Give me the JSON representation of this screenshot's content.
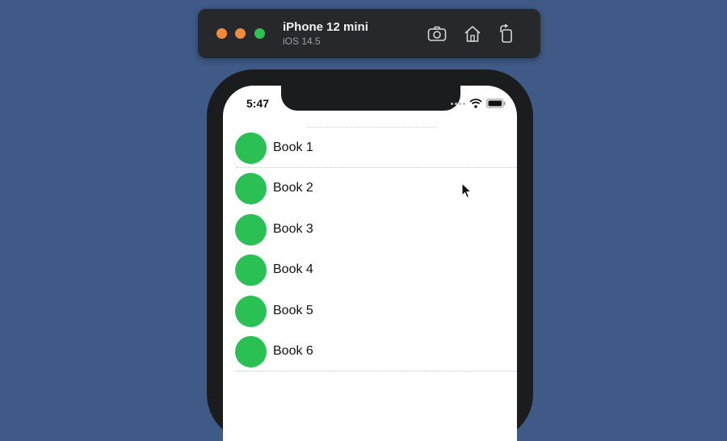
{
  "simulator": {
    "device_name": "iPhone 12 mini",
    "os_version": "iOS 14.5",
    "toolbar_icons": [
      "screenshot-icon",
      "home-icon",
      "rotate-icon"
    ]
  },
  "status_bar": {
    "time": "5:47",
    "icons": [
      "cellular-dots-icon",
      "wifi-icon",
      "battery-icon"
    ]
  },
  "list": {
    "items": [
      {
        "label": "Book 1",
        "color": "#2bc054"
      },
      {
        "label": "Book 2",
        "color": "#2bc054"
      },
      {
        "label": "Book 3",
        "color": "#2bc054"
      },
      {
        "label": "Book 4",
        "color": "#2bc054"
      },
      {
        "label": "Book 5",
        "color": "#2bc054"
      },
      {
        "label": "Book 6",
        "color": "#2bc054"
      }
    ]
  },
  "colors": {
    "desktop_background": "#3f5a86",
    "accent_green": "#2bc054",
    "traffic_orange": "#f08a3c"
  }
}
